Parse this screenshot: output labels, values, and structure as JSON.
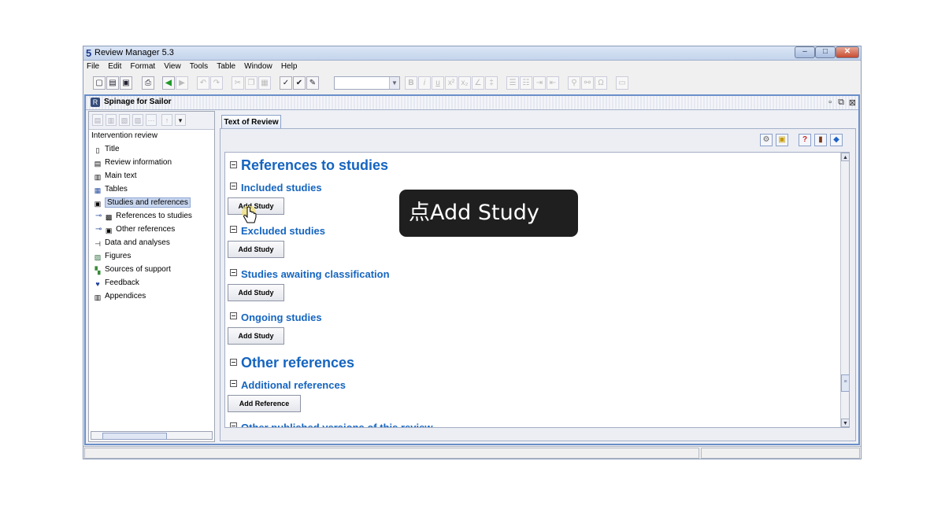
{
  "app": {
    "title": "Review Manager 5.3",
    "icon_glyph": "5"
  },
  "window_controls": {
    "minimize": "–",
    "maximize": "□",
    "close": "✕"
  },
  "menu": [
    "File",
    "Edit",
    "Format",
    "View",
    "Tools",
    "Table",
    "Window",
    "Help"
  ],
  "document": {
    "title": "Spinage for Sailor",
    "controls": [
      "▫",
      "⧉",
      "⊠"
    ]
  },
  "tree": {
    "root": "Intervention review",
    "items": [
      {
        "label": "Title",
        "icon": "title-icon"
      },
      {
        "label": "Review information",
        "icon": "info-icon"
      },
      {
        "label": "Main text",
        "icon": "document-icon"
      },
      {
        "label": "Tables",
        "icon": "table-icon"
      },
      {
        "label": "Studies and references",
        "icon": "book-icon",
        "selected": true
      },
      {
        "label": "References to studies",
        "icon": "references-icon",
        "child": true
      },
      {
        "label": "Other references",
        "icon": "book-icon",
        "child": true
      },
      {
        "label": "Data and analyses",
        "icon": "data-icon"
      },
      {
        "label": "Figures",
        "icon": "figure-icon"
      },
      {
        "label": "Sources of support",
        "icon": "support-icon"
      },
      {
        "label": "Feedback",
        "icon": "feedback-icon"
      },
      {
        "label": "Appendices",
        "icon": "appendix-icon"
      }
    ]
  },
  "tab": {
    "label": "Text of Review"
  },
  "sections": {
    "refs_to_studies": "References to studies",
    "included": "Included studies",
    "excluded": "Excluded studies",
    "awaiting": "Studies awaiting classification",
    "ongoing": "Ongoing studies",
    "other_refs": "Other references",
    "additional": "Additional references",
    "other_versions": "Other published versions of this review"
  },
  "buttons": {
    "add_study": "Add Study",
    "add_reference": "Add Reference"
  },
  "overlay": {
    "tooltip": "点Add Study"
  },
  "colors": {
    "heading": "#1565c0",
    "tooltip_bg": "#1f1f1f",
    "selection": "#c8d6ef"
  }
}
